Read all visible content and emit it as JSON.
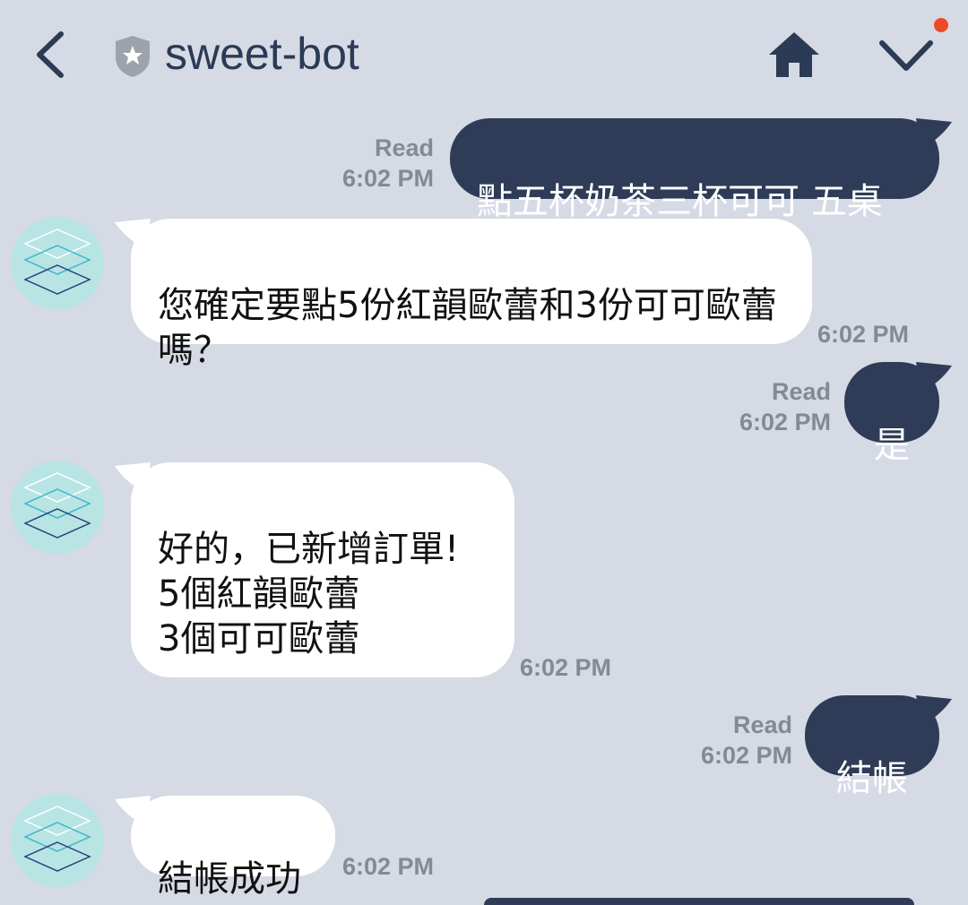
{
  "theme": {
    "background": "#d5dae4",
    "outgoing_bubble": "#2e3c57",
    "incoming_bubble": "#ffffff",
    "header_icon": "#2b3a55",
    "notification_dot": "#ee4a2a",
    "avatar_bg": "#b8e4e4"
  },
  "header": {
    "title": "sweet-bot",
    "icons": [
      "back-chevron-icon",
      "shield-star-icon",
      "home-icon",
      "chevron-down-icon"
    ]
  },
  "messages": [
    {
      "direction": "out",
      "text": "點五杯奶茶三杯可可 五桌",
      "read": "Read",
      "time": "6:02 PM"
    },
    {
      "direction": "in",
      "text": "您確定要點5份紅韻歐蕾和3份可可歐蕾嗎？",
      "time": "6:02 PM"
    },
    {
      "direction": "out",
      "text": "是",
      "read": "Read",
      "time": "6:02 PM"
    },
    {
      "direction": "in",
      "text": "好的，已新增訂單!\n5個紅韻歐蕾\n3個可可歐蕾",
      "time": "6:02 PM"
    },
    {
      "direction": "out",
      "text": "結帳",
      "read": "Read",
      "time": "6:02 PM"
    },
    {
      "direction": "in",
      "text": "結帳成功",
      "time": "6:02 PM"
    }
  ]
}
